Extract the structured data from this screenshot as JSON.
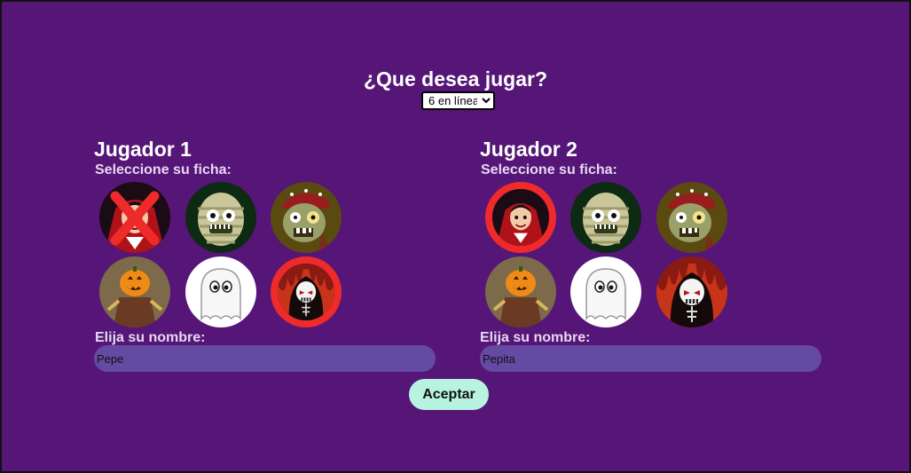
{
  "question": "¿Que desea jugar?",
  "game_select": {
    "selected": "6 en línea"
  },
  "players": [
    {
      "title": "Jugador 1",
      "token_label": "Seleccione su ficha:",
      "name_label": "Elija su nombre:",
      "name_value": "Pepe",
      "selected_token": "reaper",
      "disabled_token": "vampire"
    },
    {
      "title": "Jugador 2",
      "token_label": "Seleccione su ficha:",
      "name_label": "Elija su nombre:",
      "name_value": "Pepita",
      "selected_token": "vampire",
      "disabled_token": ""
    }
  ],
  "tokens": [
    "vampire",
    "mummy",
    "pirate-zombie",
    "pumpkin-scarecrow",
    "ghost",
    "reaper"
  ],
  "accept_label": "Aceptar",
  "colors": {
    "background": "#551677",
    "selected_ring": "#ee2a2a",
    "input": "#654aa3",
    "button": "#b7f3e0"
  }
}
